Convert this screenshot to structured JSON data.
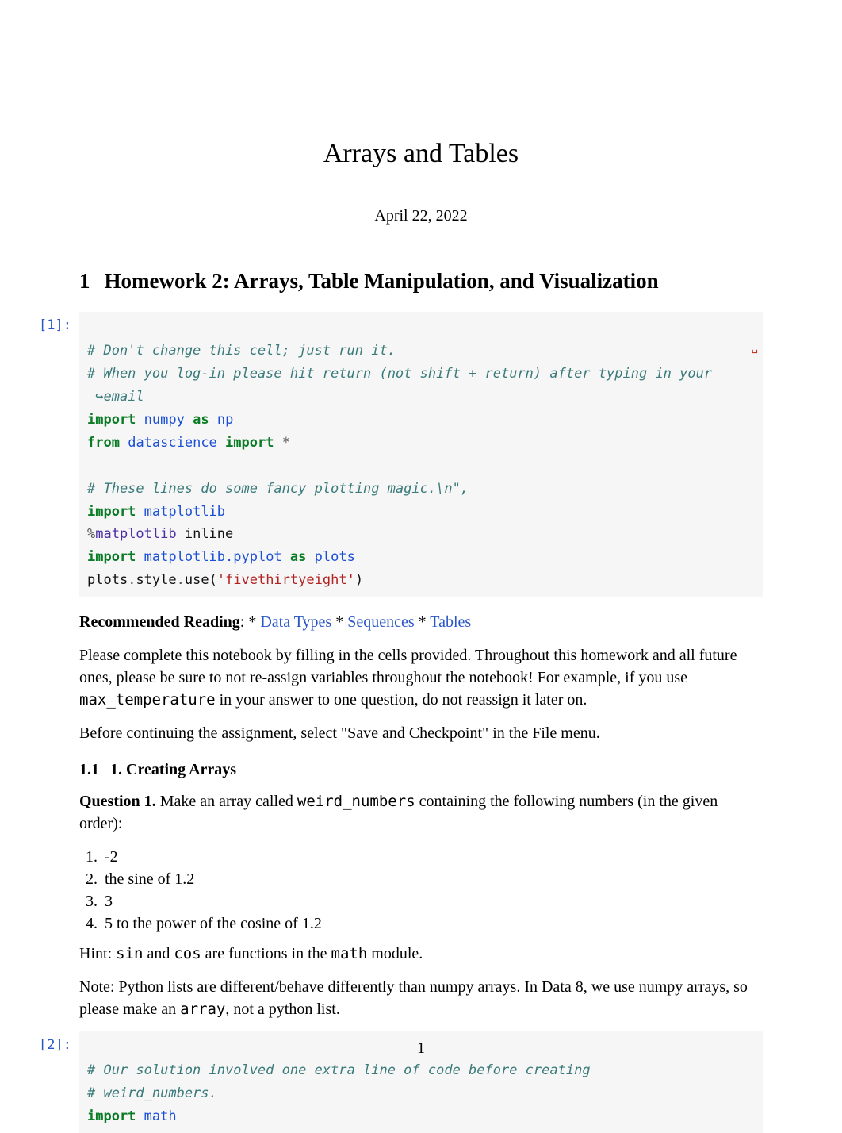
{
  "title": "Arrays and Tables",
  "date": "April 22, 2022",
  "section": {
    "num": "1",
    "title": "Homework 2: Arrays, Table Manipulation, and Visualization"
  },
  "cell1": {
    "prompt": "[1]:",
    "l1": "# Don't change this cell; just run it.",
    "l2": "# When you log-in please hit return (not shift + return) after typing in your",
    "wrap_marker": "␣",
    "l2b_prefix": " ↪",
    "l2b": "email",
    "l3_kw1": "import",
    "l3_name": "numpy",
    "l3_kw2": "as",
    "l3_alias": "np",
    "l4_kw1": "from",
    "l4_name": "datascience",
    "l4_kw2": "import",
    "l4_star": "*",
    "l5": "# These lines do some fancy plotting magic.\\n\",",
    "l6_kw": "import",
    "l6_name": "matplotlib",
    "l7_magic": "%",
    "l7_name": "matplotlib",
    "l7_arg": " inline",
    "l8_kw": "import",
    "l8_name": "matplotlib.pyplot",
    "l8_kw2": "as",
    "l8_alias": "plots",
    "l9a": "plots",
    "l9b": ".",
    "l9c": "style",
    "l9d": ".",
    "l9e": "use(",
    "l9f": "'fivethirtyeight'",
    "l9g": ")"
  },
  "reco": {
    "label": "Recommended Reading",
    "sep": ": * ",
    "link1": "Data Types",
    "sep2": " * ",
    "link2": "Sequences",
    "sep3": " * ",
    "link3": "Tables"
  },
  "p1a": "Please complete this notebook by filling in the cells provided. Throughout this homework and all future ones, please be sure to not re-assign variables throughout the notebook! For example, if you use ",
  "p1_code": "max_temperature",
  "p1b": " in your answer to one question, do not reassign it later on.",
  "p2": "Before continuing the assignment, select \"Save and Checkpoint\" in the File menu.",
  "sub1": {
    "num": "1.1",
    "title": "1. Creating Arrays"
  },
  "q1": {
    "label": "Question 1.",
    "before": " Make an array called ",
    "code": "weird_numbers",
    "after": " containing the following numbers (in the given order):",
    "items": [
      "-2",
      "the sine of 1.2",
      "3",
      "5 to the power of the cosine of 1.2"
    ]
  },
  "hint": {
    "a": "Hint: ",
    "b": "sin",
    "c": " and ",
    "d": "cos",
    "e": " are functions in the ",
    "f": "math",
    "g": " module."
  },
  "note": {
    "a": "Note: ",
    "b": "Python lists are different/behave differently than numpy arrays. In Data 8, we use numpy arrays, so please make an ",
    "c": "array",
    "d": ", not a python list."
  },
  "cell2": {
    "prompt": "[2]:",
    "l1": "# Our solution involved one extra line of code before creating",
    "l2": "# weird_numbers.",
    "l3_kw": "import",
    "l3_name": "math"
  },
  "page_number": "1"
}
